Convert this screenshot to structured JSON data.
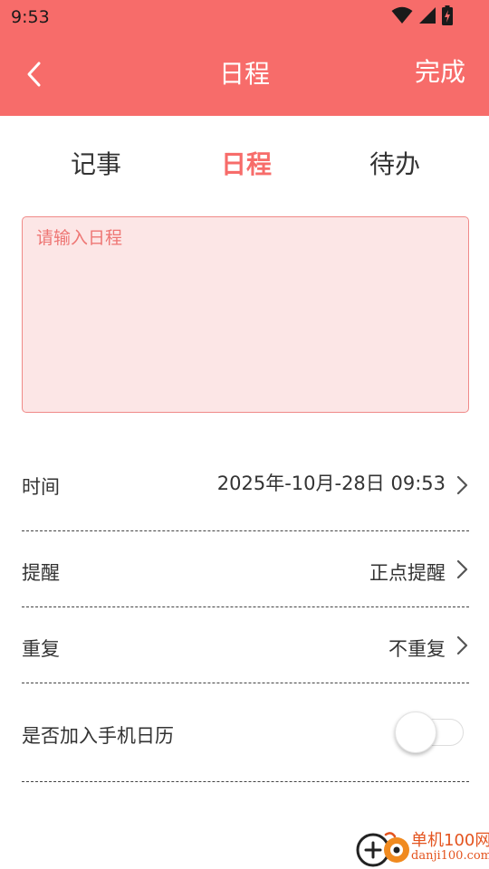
{
  "status_bar": {
    "time": "9:53",
    "icons": [
      "wifi-icon",
      "signal-icon",
      "battery-charging-icon"
    ]
  },
  "header": {
    "title": "日程",
    "back_icon": "chevron-left-icon",
    "done_label": "完成"
  },
  "tabs": [
    {
      "label": "记事",
      "active": false
    },
    {
      "label": "日程",
      "active": true
    },
    {
      "label": "待办",
      "active": false
    }
  ],
  "schedule_input": {
    "value": "",
    "placeholder": "请输入日程"
  },
  "settings": {
    "time": {
      "label": "时间",
      "value": "2025年-10月-28日 09:53"
    },
    "remind": {
      "label": "提醒",
      "value": "正点提醒"
    },
    "repeat": {
      "label": "重复",
      "value": "不重复"
    },
    "add_to_calendar": {
      "label": "是否加入手机日历",
      "enabled": false
    }
  },
  "watermark": {
    "text": "单机100网",
    "url_text": "danji100.com"
  },
  "colors": {
    "accent": "#F76C6A",
    "input_bg": "#FCE6E6",
    "text": "#333333",
    "watermark": "#E4541F"
  }
}
